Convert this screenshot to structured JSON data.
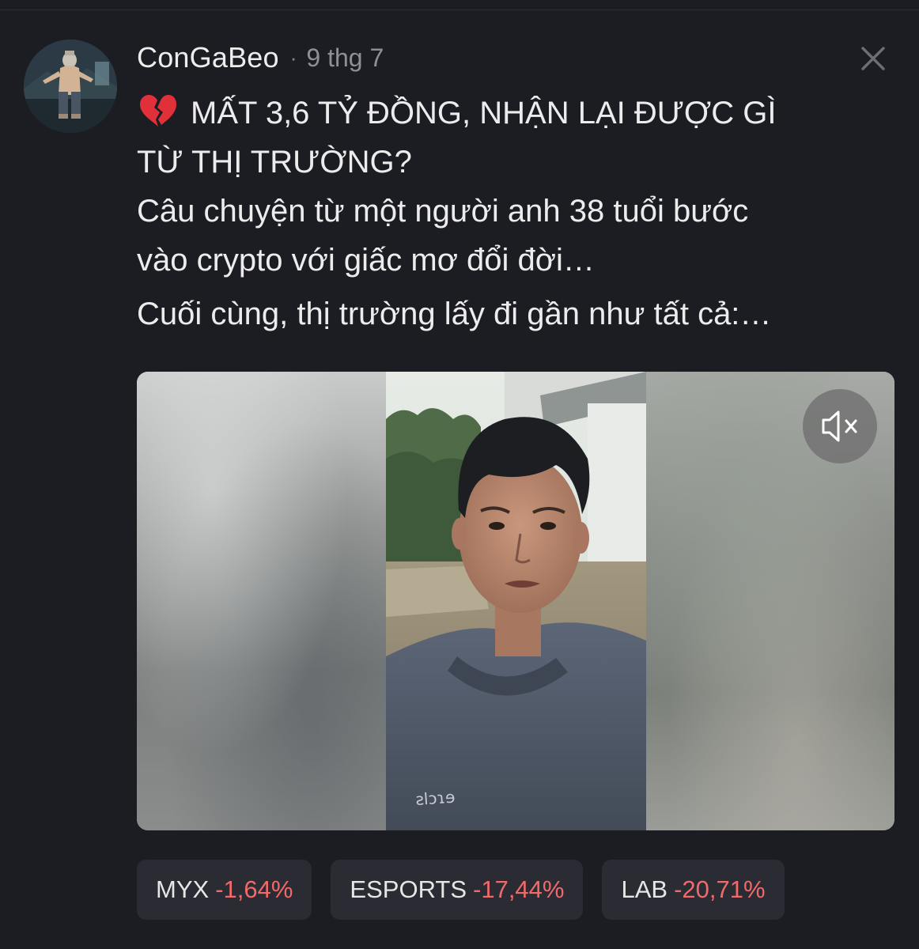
{
  "post": {
    "username": "ConGaBeo",
    "separator": "·",
    "time": "9 thg 7",
    "title_icon": "broken-heart-icon",
    "title_line1": "MẤT 3,6 TỶ ĐỒNG, NHẬN LẠI ĐƯỢC GÌ",
    "title_line2": "TỪ THỊ TRƯỜNG?",
    "body_line1": "Câu chuyện từ một người anh 38 tuổi bước",
    "body_line2": "vào crypto với giấc mơ đổi đời…",
    "body_line3": "Cuối cùng, thị trường lấy đi gần như tất cả:…"
  },
  "media": {
    "mute_icon": "speaker-muted-icon"
  },
  "tickers": [
    {
      "symbol": "MYX",
      "change": "-1,64%"
    },
    {
      "symbol": "ESPORTS",
      "change": "-17,44%"
    },
    {
      "symbol": "LAB",
      "change": "-20,71%"
    }
  ],
  "colors": {
    "background": "#1c1d23",
    "negative": "#ef6a6a",
    "ticker_bg": "#2b2c33",
    "muted_text": "#8f9097"
  }
}
